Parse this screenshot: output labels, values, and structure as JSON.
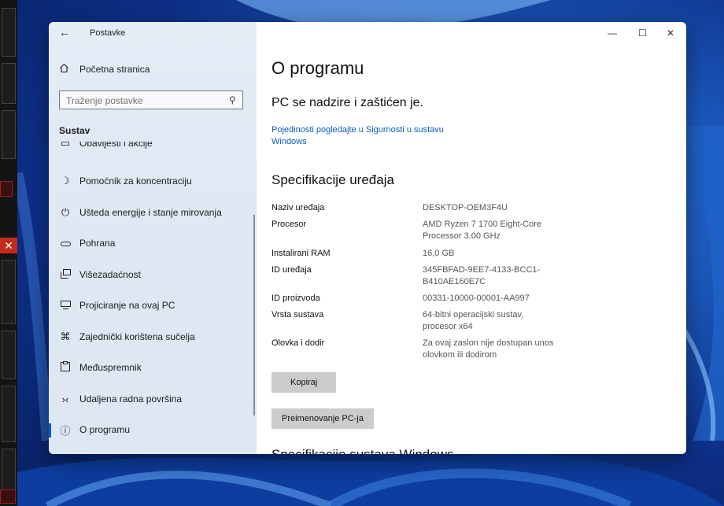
{
  "window": {
    "app_title": "Postavke",
    "controls": {
      "minimize": "—",
      "maximize": "☐",
      "close": "✕"
    }
  },
  "sidebar": {
    "home_label": "Početna stranica",
    "search_placeholder": "Traženje postavke",
    "section_title": "Sustav",
    "clipped_item": "Obavijesti i akcije",
    "items": [
      {
        "label": "Pomoćnik za koncentraciju",
        "icon": "moon-icon"
      },
      {
        "label": "Ušteda energije i stanje mirovanja",
        "icon": "power-icon"
      },
      {
        "label": "Pohrana",
        "icon": "storage-icon"
      },
      {
        "label": "Višezadaćnost",
        "icon": "multitasking-icon"
      },
      {
        "label": "Projiciranje na ovaj PC",
        "icon": "projector-icon"
      },
      {
        "label": "Zajednički korištena sučelja",
        "icon": "shared-icon"
      },
      {
        "label": "Međuspremnik",
        "icon": "clipboard-icon"
      },
      {
        "label": "Udaljena radna površina",
        "icon": "remote-desktop-icon"
      },
      {
        "label": "O programu",
        "icon": "info-icon",
        "active": true
      }
    ],
    "accent_color": "#0a5cc0"
  },
  "main": {
    "page_title": "O programu",
    "status_text": "PC se nadzire i zaštićen je.",
    "security_link": "Pojedinosti pogledajte u Sigurnosti u sustavu Windows",
    "spec_title": "Specifikacije uređaja",
    "specs": [
      {
        "name": "Naziv uređaja",
        "value": "DESKTOP-OEM3F4U"
      },
      {
        "name": "Procesor",
        "value": "AMD Ryzen 7 1700 Eight-Core Processor 3.00 GHz"
      },
      {
        "name": "Instalirani RAM",
        "value": "16,0 GB"
      },
      {
        "name": "ID uređaja",
        "value": "345FBFAD-9EE7-4133-BCC1-B410AE160E7C"
      },
      {
        "name": "ID proizvoda",
        "value": "00331-10000-00001-AA997"
      },
      {
        "name": "Vrsta sustava",
        "value": "64-bitni operacijski sustav, procesor x64"
      },
      {
        "name": "Olovka i dodir",
        "value": "Za ovaj zaslon nije dostupan unos olovkom ili dodirom"
      }
    ],
    "copy_button": "Kopiraj",
    "rename_button": "Preimenovanje PC-ja",
    "next_section_title": "Specifikacije sustava Windows"
  }
}
